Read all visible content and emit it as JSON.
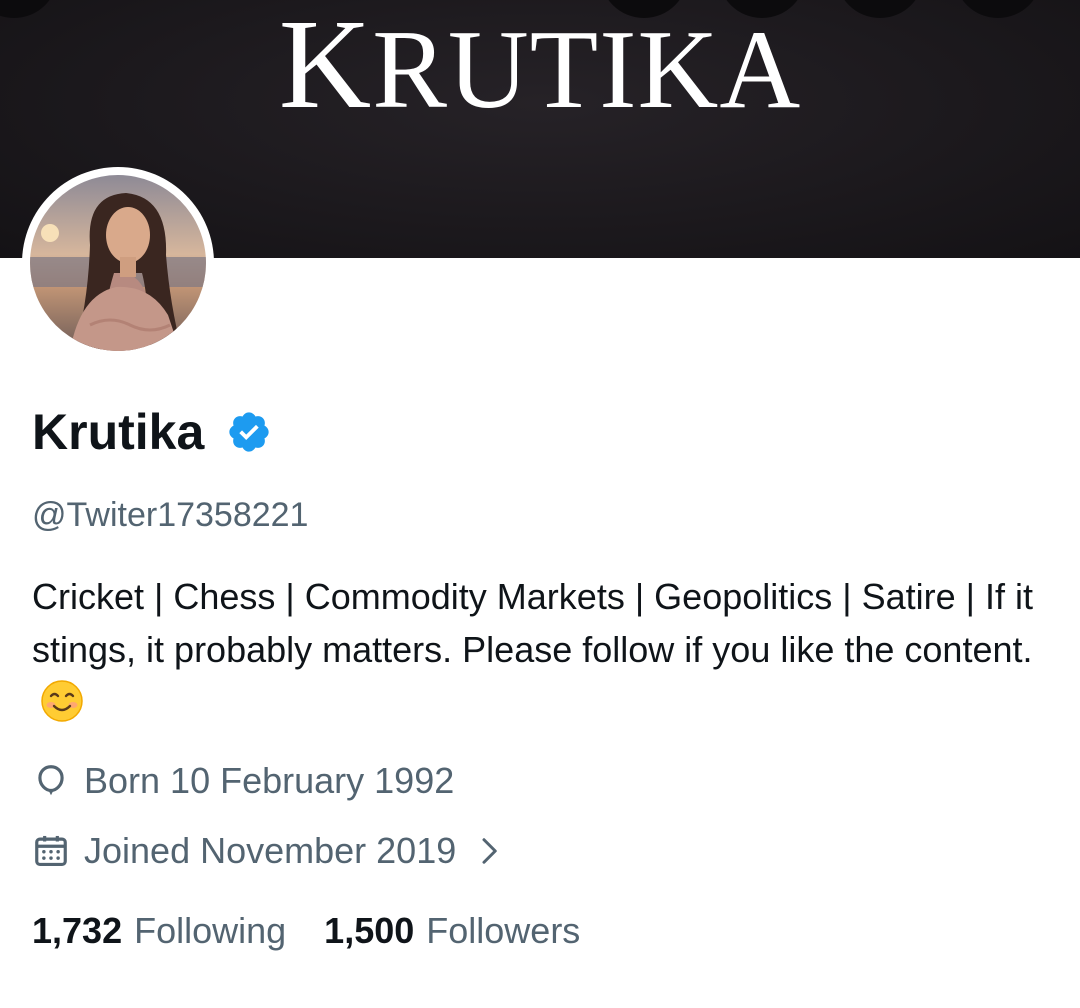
{
  "banner": {
    "title_initial": "K",
    "title_rest": "RUTIKA"
  },
  "profile": {
    "display_name": "Krutika",
    "handle": "@Twiter17358221",
    "verified": true,
    "accent_color": "#1d9bf0",
    "bio": "Cricket | Chess | Commodity Markets | Geopolitics | Satire | If it stings, it probably matters. Please follow if you like the content.",
    "bio_emoji": "smiling-face-icon",
    "birthday_icon": "balloon-icon",
    "birthday": "Born 10 February 1992",
    "joined_icon": "calendar-icon",
    "joined": "Joined November 2019"
  },
  "stats": {
    "following_count": "1,732",
    "following_label": "Following",
    "followers_count": "1,500",
    "followers_label": "Followers"
  }
}
